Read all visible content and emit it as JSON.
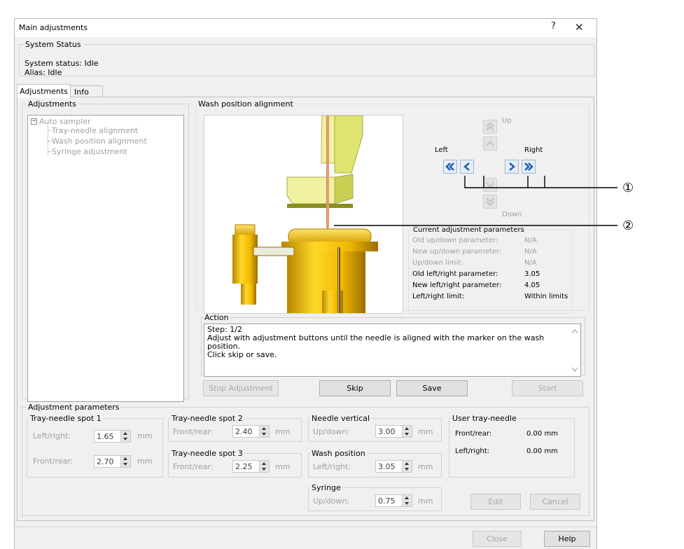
{
  "window": {
    "title": "Main adjustments",
    "help_btn": "?",
    "close_btn": "✕"
  },
  "system_status": {
    "legend": "System Status",
    "status_line": "System status: Idle",
    "alias_line": "Alias: Idle"
  },
  "tabs": [
    {
      "label": "Adjustments"
    },
    {
      "label": "Info"
    }
  ],
  "adjustments_tree": {
    "legend": "Adjustments",
    "root": "Auto sampler",
    "items": [
      {
        "label": "Tray-needle alignment"
      },
      {
        "label": "Wash position alignment"
      },
      {
        "label": "Syringe adjustment"
      }
    ]
  },
  "wash": {
    "legend": "Wash position alignment",
    "up": "Up",
    "down": "Down",
    "left": "Left",
    "right": "Right"
  },
  "current_params": {
    "legend": "Current adjustment parameters",
    "rows": [
      {
        "label": "Old up/down parameter:",
        "value": "N/A",
        "active": false
      },
      {
        "label": "New up/down parameter:",
        "value": "N/A",
        "active": false
      },
      {
        "label": "Up/down limit:",
        "value": "N/A",
        "active": false
      },
      {
        "label": "Old left/right parameter:",
        "value": "3.05",
        "active": true
      },
      {
        "label": "New left/right parameter:",
        "value": "4.05",
        "active": true
      },
      {
        "label": "Left/right limit:",
        "value": "Within limits",
        "active": true
      }
    ]
  },
  "callouts": {
    "one": "①",
    "two": "②"
  },
  "action": {
    "legend": "Action",
    "step": "Step: 1/2",
    "text1": "Adjust with adjustment buttons until the needle is aligned with the marker on the wash",
    "text2": "position.",
    "text3": "Click skip or save."
  },
  "buttons": {
    "stop": "Stop Adjustment",
    "skip": "Skip",
    "save": "Save",
    "start": "Start",
    "edit": "Edit",
    "cancel": "Cancel",
    "close": "Close",
    "help": "Help"
  },
  "adj_params": {
    "legend": "Adjustment parameters",
    "spot1": {
      "legend": "Tray-needle spot 1",
      "lr_label": "Left/right:",
      "lr_value": "1.65",
      "fr_label": "Front/rear:",
      "fr_value": "2.70",
      "unit": "mm"
    },
    "spot2": {
      "legend": "Tray-needle spot  2",
      "fr_label": "Front/rear:",
      "fr_value": "2.40",
      "unit": "mm"
    },
    "spot3": {
      "legend": "Tray-needle spot 3",
      "fr_label": "Front/rear:",
      "fr_value": "2.25",
      "unit": "mm"
    },
    "needle_vertical": {
      "legend": "Needle vertical",
      "label": "Up/down:",
      "value": "3.00",
      "unit": "mm"
    },
    "wash_position": {
      "legend": "Wash position",
      "label": "Left/right:",
      "value": "3.05",
      "unit": "mm"
    },
    "syringe": {
      "legend": "Syringe",
      "label": "Up/down:",
      "value": "0.75",
      "unit": "mm"
    },
    "user_tray": {
      "legend": "User tray-needle",
      "fr_label": "Front/rear:",
      "fr_value": "0.00 mm",
      "lr_label": "Left/right:",
      "lr_value": "0.00 mm"
    }
  }
}
